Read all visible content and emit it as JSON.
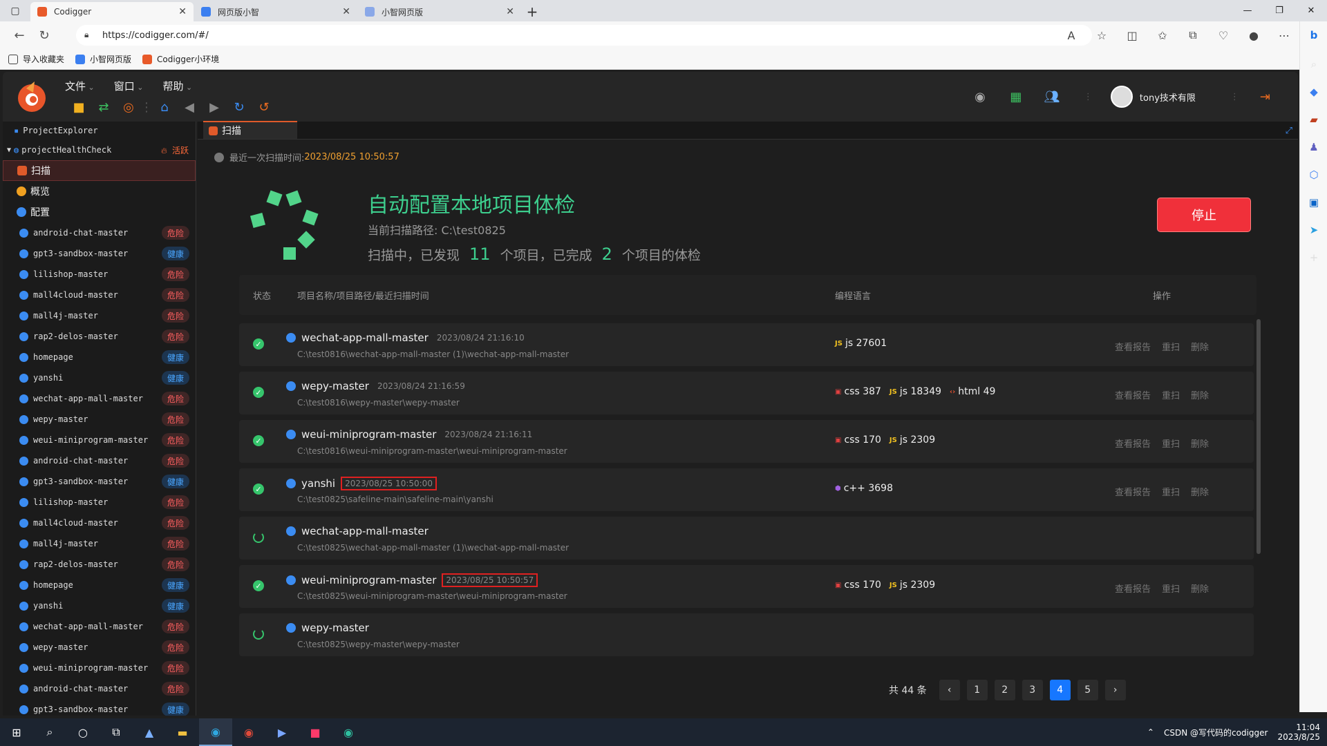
{
  "browser": {
    "tabs": [
      {
        "title": "Codigger",
        "active": true
      },
      {
        "title": "网页版小智",
        "active": false
      },
      {
        "title": "小智网页版",
        "active": false
      }
    ],
    "url": "https://codigger.com/#/",
    "bookmarks": [
      "导入收藏夹",
      "小智网页版",
      "Codigger小环境"
    ]
  },
  "app": {
    "menus": [
      "文件",
      "窗口",
      "帮助"
    ],
    "user": "tony技术有限",
    "sidebar": {
      "title": "ProjectExplorer",
      "root": "projectHealthCheck",
      "root_badge": "活跃",
      "items": [
        "扫描",
        "概览",
        "配置"
      ],
      "projects": [
        {
          "name": "android-chat-master",
          "status": "危险",
          "type": "danger"
        },
        {
          "name": "gpt3-sandbox-master",
          "status": "健康",
          "type": "ok"
        },
        {
          "name": "lilishop-master",
          "status": "危险",
          "type": "danger"
        },
        {
          "name": "mall4cloud-master",
          "status": "危险",
          "type": "danger"
        },
        {
          "name": "mall4j-master",
          "status": "危险",
          "type": "danger"
        },
        {
          "name": "rap2-delos-master",
          "status": "危险",
          "type": "danger"
        },
        {
          "name": "homepage",
          "status": "健康",
          "type": "ok"
        },
        {
          "name": "yanshi",
          "status": "健康",
          "type": "ok"
        },
        {
          "name": "wechat-app-mall-master",
          "status": "危险",
          "type": "danger"
        },
        {
          "name": "wepy-master",
          "status": "危险",
          "type": "danger"
        },
        {
          "name": "weui-miniprogram-master",
          "status": "危险",
          "type": "danger"
        },
        {
          "name": "android-chat-master",
          "status": "危险",
          "type": "danger"
        },
        {
          "name": "gpt3-sandbox-master",
          "status": "健康",
          "type": "ok"
        },
        {
          "name": "lilishop-master",
          "status": "危险",
          "type": "danger"
        },
        {
          "name": "mall4cloud-master",
          "status": "危险",
          "type": "danger"
        },
        {
          "name": "mall4j-master",
          "status": "危险",
          "type": "danger"
        },
        {
          "name": "rap2-delos-master",
          "status": "危险",
          "type": "danger"
        },
        {
          "name": "homepage",
          "status": "健康",
          "type": "ok"
        },
        {
          "name": "yanshi",
          "status": "健康",
          "type": "ok"
        },
        {
          "name": "wechat-app-mall-master",
          "status": "危险",
          "type": "danger"
        },
        {
          "name": "wepy-master",
          "status": "危险",
          "type": "danger"
        },
        {
          "name": "weui-miniprogram-master",
          "status": "危险",
          "type": "danger"
        },
        {
          "name": "android-chat-master",
          "status": "危险",
          "type": "danger"
        },
        {
          "name": "gpt3-sandbox-master",
          "status": "健康",
          "type": "ok"
        }
      ]
    },
    "main": {
      "tab": "扫描",
      "last_scan_label": "最近一次扫描时间:",
      "last_scan_time": "2023/08/25 10:50:57",
      "title": "自动配置本地项目体检",
      "scan_path": "当前扫描路径: C:\\test0825",
      "progress_prefix": "扫描中，已发现",
      "found": "11",
      "progress_mid": "个项目，已完成",
      "done": "2",
      "progress_suffix": "个项目的体检",
      "stop_label": "停止",
      "columns": [
        "状态",
        "项目名称/项目路径/最近扫描时间",
        "编程语言",
        "操作"
      ],
      "rows": [
        {
          "status": "done",
          "name": "wechat-app-mall-master",
          "time": "2023/08/24 21:16:10",
          "highlight": false,
          "path": "C:\\test0816\\wechat-app-mall-master (1)\\wechat-app-mall-master",
          "langs": [
            {
              "icon": "JS",
              "color": "#f0c020",
              "label": "js 27601"
            }
          ],
          "ops": [
            "查看报告",
            "重扫",
            "删除"
          ]
        },
        {
          "status": "done",
          "name": "wepy-master",
          "time": "2023/08/24 21:16:59",
          "highlight": false,
          "path": "C:\\test0816\\wepy-master\\wepy-master",
          "langs": [
            {
              "icon": "▣",
              "color": "#e04040",
              "label": "css 387"
            },
            {
              "icon": "JS",
              "color": "#f0c020",
              "label": "js 18349"
            },
            {
              "icon": "‹›",
              "color": "#e05030",
              "label": "html 49"
            }
          ],
          "ops": [
            "查看报告",
            "重扫",
            "删除"
          ]
        },
        {
          "status": "done",
          "name": "weui-miniprogram-master",
          "time": "2023/08/24 21:16:11",
          "highlight": false,
          "path": "C:\\test0816\\weui-miniprogram-master\\weui-miniprogram-master",
          "langs": [
            {
              "icon": "▣",
              "color": "#e04040",
              "label": "css 170"
            },
            {
              "icon": "JS",
              "color": "#f0c020",
              "label": "js 2309"
            }
          ],
          "ops": [
            "查看报告",
            "重扫",
            "删除"
          ]
        },
        {
          "status": "done",
          "name": "yanshi",
          "time": "2023/08/25 10:50:00",
          "highlight": true,
          "path": "C:\\test0825\\safeline-main\\safeline-main\\yanshi",
          "langs": [
            {
              "icon": "⬢",
              "color": "#a060e0",
              "label": "c++ 3698"
            }
          ],
          "ops": [
            "查看报告",
            "重扫",
            "删除"
          ]
        },
        {
          "status": "scanning",
          "name": "wechat-app-mall-master",
          "time": "",
          "highlight": false,
          "path": "C:\\test0825\\wechat-app-mall-master (1)\\wechat-app-mall-master",
          "langs": [],
          "ops": []
        },
        {
          "status": "done",
          "name": "weui-miniprogram-master",
          "time": "2023/08/25 10:50:57",
          "highlight": true,
          "path": "C:\\test0825\\weui-miniprogram-master\\weui-miniprogram-master",
          "langs": [
            {
              "icon": "▣",
              "color": "#e04040",
              "label": "css 170"
            },
            {
              "icon": "JS",
              "color": "#f0c020",
              "label": "js 2309"
            }
          ],
          "ops": [
            "查看报告",
            "重扫",
            "删除"
          ]
        },
        {
          "status": "scanning",
          "name": "wepy-master",
          "time": "",
          "highlight": false,
          "path": "C:\\test0825\\wepy-master\\wepy-master",
          "langs": [],
          "ops": []
        }
      ],
      "pager": {
        "total": "共 44 条",
        "pages": [
          "1",
          "2",
          "3",
          "4",
          "5"
        ],
        "current": "4"
      }
    }
  },
  "taskbar": {
    "tray_text": "CSDN @写代码的codigger",
    "time": "11:04",
    "date": "2023/8/25"
  },
  "colors": {
    "accent": "#1677ff",
    "success": "#3dcf8e",
    "danger": "#f0303a",
    "warn": "#f0a030"
  }
}
